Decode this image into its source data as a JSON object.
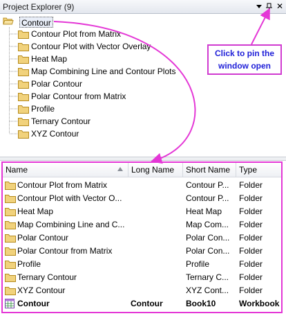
{
  "window": {
    "title": "Project Explorer (9)"
  },
  "titlebar": {
    "pin_icon": "pin-icon",
    "close_label": "✕"
  },
  "tree": {
    "root": "Contour",
    "items": [
      "Contour Plot from Matrix",
      "Contour Plot with Vector Overlay",
      "Heat Map",
      "Map Combining Line and Contour Plots",
      "Polar Contour",
      "Polar Contour from Matrix",
      "Profile",
      "Ternary Contour",
      "XYZ Contour"
    ]
  },
  "callout": {
    "line1": "Click to pin the",
    "line2": "window open"
  },
  "list": {
    "columns": [
      "Name",
      "Long Name",
      "Short Name",
      "Type"
    ],
    "rows": [
      {
        "name": "Contour Plot from Matrix",
        "long": "",
        "short": "Contour P...",
        "type": "Folder",
        "icon": "folder"
      },
      {
        "name": "Contour Plot with Vector O...",
        "long": "",
        "short": "Contour P...",
        "type": "Folder",
        "icon": "folder"
      },
      {
        "name": "Heat Map",
        "long": "",
        "short": "Heat Map",
        "type": "Folder",
        "icon": "folder"
      },
      {
        "name": "Map Combining Line and C...",
        "long": "",
        "short": "Map Com...",
        "type": "Folder",
        "icon": "folder"
      },
      {
        "name": "Polar Contour",
        "long": "",
        "short": "Polar Con...",
        "type": "Folder",
        "icon": "folder"
      },
      {
        "name": "Polar Contour from Matrix",
        "long": "",
        "short": "Polar Con...",
        "type": "Folder",
        "icon": "folder"
      },
      {
        "name": "Profile",
        "long": "",
        "short": "Profile",
        "type": "Folder",
        "icon": "folder"
      },
      {
        "name": "Ternary Contour",
        "long": "",
        "short": "Ternary C...",
        "type": "Folder",
        "icon": "folder"
      },
      {
        "name": "XYZ Contour",
        "long": "",
        "short": "XYZ Cont...",
        "type": "Folder",
        "icon": "folder"
      },
      {
        "name": "Contour",
        "long": "Contour",
        "short": "Book10",
        "type": "Workbook",
        "icon": "workbook",
        "bold": true
      }
    ]
  },
  "colors": {
    "annotation": "#e437d6",
    "callout_text": "#1f1fd8",
    "folder": "#e8c25a"
  }
}
